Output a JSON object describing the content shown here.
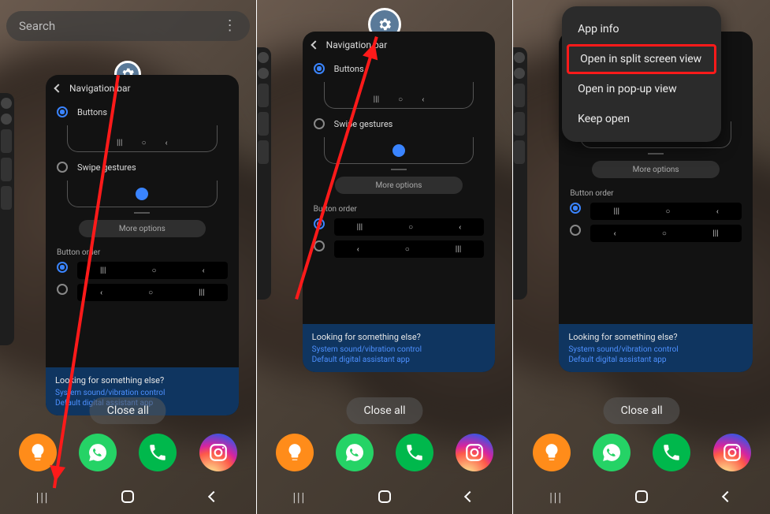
{
  "search": {
    "placeholder": "Search"
  },
  "card": {
    "title": "Navigation bar",
    "option_buttons": "Buttons",
    "option_swipe": "Swipe gestures",
    "more_options": "More options",
    "button_order": "Button order",
    "help_title": "Looking for something else?",
    "help_link1": "System sound/vibration control",
    "help_link2": "Default digital assistant app",
    "nav_glyphs": {
      "recents": "|||",
      "home": "○",
      "back": "‹"
    }
  },
  "close_all": "Close all",
  "popup": {
    "app_info": "App info",
    "split": "Open in split screen view",
    "popup_view": "Open in pop-up view",
    "keep_open": "Keep open"
  },
  "apps": {
    "bulb": "tips-app",
    "whatsapp": "whatsapp-app",
    "phone": "phone-app",
    "instagram": "instagram-app"
  }
}
